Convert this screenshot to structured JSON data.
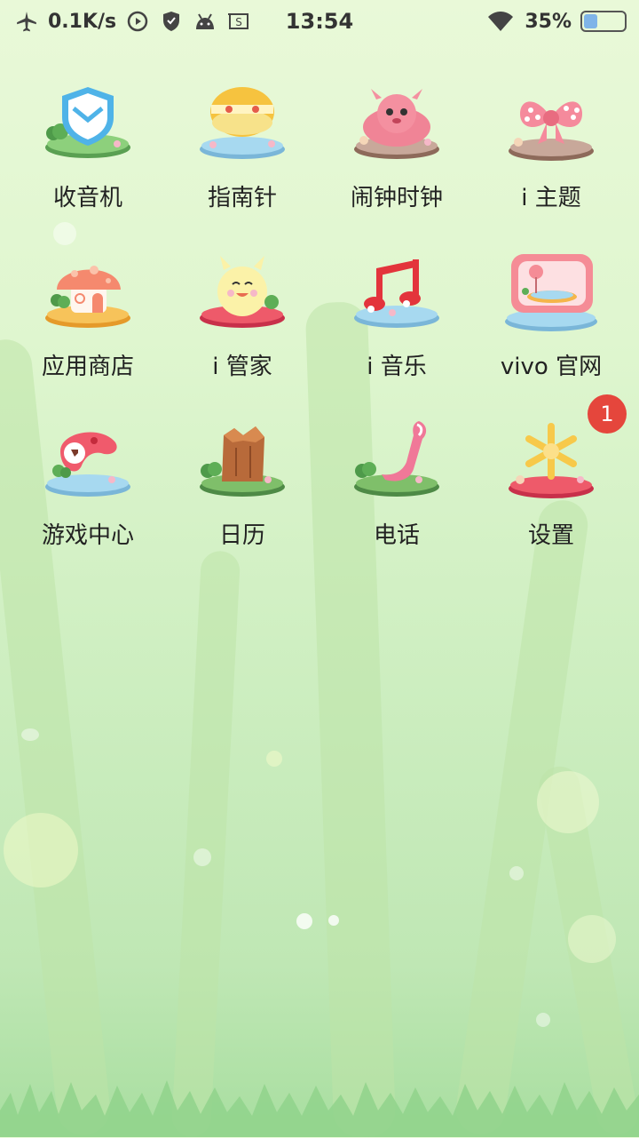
{
  "status_bar": {
    "speed": "0.1K/s",
    "time": "13:54",
    "battery_percent": "35%",
    "battery_level": 0.35,
    "icons": [
      "airplane-icon",
      "media-play-icon",
      "shield-icon",
      "android-icon",
      "screenshot-icon",
      "wifi-icon",
      "battery-icon"
    ]
  },
  "apps": [
    {
      "label": "收音机",
      "icon": "radio-shield-icon"
    },
    {
      "label": "指南针",
      "icon": "compass-icon"
    },
    {
      "label": "闹钟时钟",
      "icon": "alarm-clock-icon"
    },
    {
      "label": "i 主题",
      "icon": "theme-bow-icon"
    },
    {
      "label": "应用商店",
      "icon": "app-store-mushroom-icon"
    },
    {
      "label": "i 管家",
      "icon": "manager-chick-icon"
    },
    {
      "label": "i 音乐",
      "icon": "music-note-icon"
    },
    {
      "label": "vivo 官网",
      "icon": "vivo-website-icon"
    },
    {
      "label": "游戏中心",
      "icon": "game-center-icon"
    },
    {
      "label": "日历",
      "icon": "calendar-stump-icon"
    },
    {
      "label": "电话",
      "icon": "phone-icon"
    },
    {
      "label": "设置",
      "icon": "settings-snowflake-icon",
      "badge": "1"
    }
  ],
  "colors": {
    "badge": "#e5463c",
    "label_text": "#222222"
  }
}
